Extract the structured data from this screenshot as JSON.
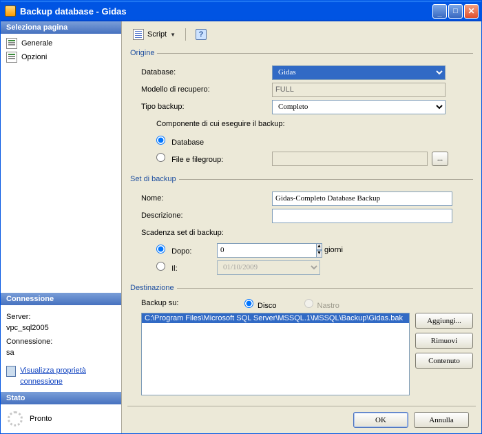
{
  "window": {
    "title": "Backup database - Gidas"
  },
  "sidebar": {
    "select_page": {
      "header": "Seleziona pagina",
      "items": [
        "Generale",
        "Opzioni"
      ]
    },
    "connection": {
      "header": "Connessione",
      "server_label": "Server:",
      "server_value": "vpc_sql2005",
      "conn_label": "Connessione:",
      "conn_value": "sa",
      "view_props": "Visualizza proprietà connessione"
    },
    "state": {
      "header": "Stato",
      "value": "Pronto"
    }
  },
  "toolbar": {
    "script": "Script",
    "help": "?"
  },
  "origin": {
    "legend": "Origine",
    "database_label": "Database:",
    "database_value": "Gidas",
    "recovery_label": "Modello di recupero:",
    "recovery_value": "FULL",
    "type_label": "Tipo backup:",
    "type_value": "Completo",
    "component_label": "Componente di cui eseguire il backup:",
    "radio_db": "Database",
    "radio_fg": "File e filegroup:",
    "fg_browse": "..."
  },
  "set": {
    "legend": "Set di backup",
    "name_label": "Nome:",
    "name_value": "Gidas-Completo Database Backup",
    "desc_label": "Descrizione:",
    "desc_value": "",
    "expiry_label": "Scadenza set di backup:",
    "after_label": "Dopo:",
    "after_value": "0",
    "after_unit": "giorni",
    "on_label": "Il:",
    "on_value": "01/10/2009"
  },
  "dest": {
    "legend": "Destinazione",
    "to_label": "Backup su:",
    "radio_disk": "Disco",
    "radio_tape": "Nastro",
    "path": "C:\\Program Files\\Microsoft SQL Server\\MSSQL.1\\MSSQL\\Backup\\Gidas.bak",
    "btn_add": "Aggiungi...",
    "btn_remove": "Rimuovi",
    "btn_contents": "Contenuto"
  },
  "footer": {
    "ok": "OK",
    "cancel": "Annulla"
  }
}
